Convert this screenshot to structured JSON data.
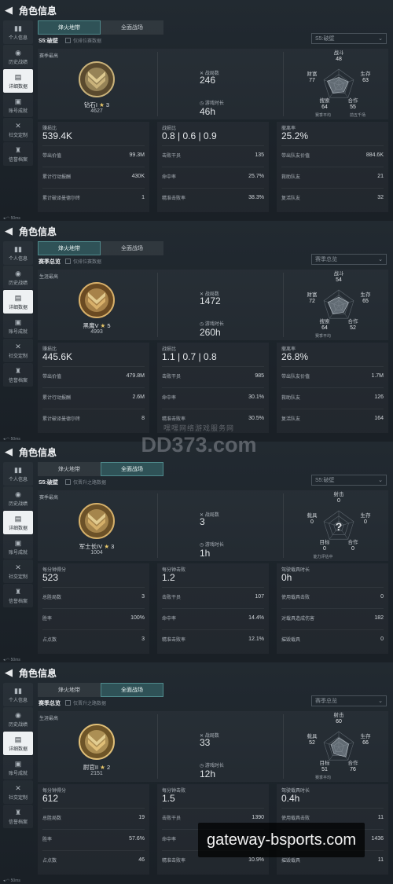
{
  "app": {
    "title": "角色信息",
    "footer": "50ms"
  },
  "sidebar": [
    "个人信息",
    "历史战绩",
    "详细数据",
    "账号成就",
    "社交定制",
    "信誉档案"
  ],
  "tabs": [
    "烽火地带",
    "全面战场"
  ],
  "watermark": {
    "site": "DD373.com",
    "sub": "嘿嘿网络游戏服务网"
  },
  "promo": {
    "text": "gateway-bsports.com"
  },
  "panels": [
    {
      "season": "S5:破壁",
      "checkbox": "仅排位赛数据",
      "dropdown": "S5:破壁",
      "main_label": "赛季最高",
      "rank_name": "钻石I",
      "rank_star": "3",
      "rank_points": "4627",
      "mid": [
        {
          "k": "战局数",
          "v": "246"
        },
        {
          "k": "游戏时长",
          "v": "46h"
        }
      ],
      "radar": {
        "labels": [
          "战斗",
          "生存",
          "合作",
          "搜索",
          "财富"
        ],
        "values": [
          "48",
          "63",
          "55",
          "64",
          "77"
        ],
        "legend": [
          "赛季平均",
          "前五千场"
        ]
      },
      "cols": [
        {
          "hk": "赚损比",
          "hv": "539.4K",
          "rows": [
            [
              "带出价值",
              "99.3M"
            ],
            [
              "累计行动报酬",
              "430K"
            ],
            [
              "累计破译曼德尔砖",
              "1"
            ]
          ]
        },
        {
          "hk": "战损比",
          "hv": "0.8 | 0.6 | 0.9",
          "rows": [
            [
              "击败干员",
              "135"
            ],
            [
              "命中率",
              "25.7%"
            ],
            [
              "精准击败率",
              "38.3%"
            ]
          ]
        },
        {
          "hk": "撤离率",
          "hv": "25.2%",
          "rows": [
            [
              "带出队友价值",
              "884.6K"
            ],
            [
              "救助队友",
              "21"
            ],
            [
              "复活队友",
              "32"
            ]
          ]
        }
      ]
    },
    {
      "season": "赛季总览",
      "checkbox": "仅排位赛数据",
      "dropdown": "赛季总览",
      "main_label": "生涯最高",
      "rank_name": "黑鹰V",
      "rank_star": "5",
      "rank_points": "4993",
      "mid": [
        {
          "k": "战局数",
          "v": "1472"
        },
        {
          "k": "游戏时长",
          "v": "260h"
        }
      ],
      "radar": {
        "labels": [
          "战斗",
          "生存",
          "合作",
          "搜索",
          "财富"
        ],
        "values": [
          "54",
          "65",
          "52",
          "64",
          "72"
        ],
        "legend": [
          "赛季平均"
        ]
      },
      "cols": [
        {
          "hk": "赚损比",
          "hv": "445.6K",
          "rows": [
            [
              "带出价值",
              "479.8M"
            ],
            [
              "累计行动报酬",
              "2.6M"
            ],
            [
              "累计破译曼德尔砖",
              "8"
            ]
          ]
        },
        {
          "hk": "战损比",
          "hv": "1.1 | 0.7 | 0.8",
          "rows": [
            [
              "击败干员",
              "985"
            ],
            [
              "命中率",
              "30.1%"
            ],
            [
              "精准击败率",
              "30.5%"
            ]
          ]
        },
        {
          "hk": "撤离率",
          "hv": "26.8%",
          "rows": [
            [
              "带出队友价值",
              "1.7M"
            ],
            [
              "救助队友",
              "126"
            ],
            [
              "复活队友",
              "164"
            ]
          ]
        }
      ]
    },
    {
      "season": "S5:破壁",
      "checkbox": "仅晋升之路数据",
      "dropdown": "S5:破壁",
      "main_label": "赛季最高",
      "rank_name": "军士长IV",
      "rank_star": "3",
      "rank_points": "1004",
      "mid": [
        {
          "k": "战局数",
          "v": "3"
        },
        {
          "k": "游戏时长",
          "v": "1h"
        }
      ],
      "radar": {
        "labels": [
          "射击",
          "生存",
          "合作",
          "目标",
          "载具"
        ],
        "values": [
          "0",
          "0",
          "0",
          "0",
          "0"
        ],
        "legend": [
          "能力评估中"
        ]
      },
      "cols": [
        {
          "hk": "每分钟得分",
          "hv": "523",
          "rows": [
            [
              "总胜局数",
              "3"
            ],
            [
              "胜率",
              "100%"
            ],
            [
              "占点数",
              "3"
            ]
          ]
        },
        {
          "hk": "每分钟击败",
          "hv": "1.2",
          "rows": [
            [
              "击败干员",
              "107"
            ],
            [
              "命中率",
              "14.4%"
            ],
            [
              "精准击败率",
              "12.1%"
            ]
          ]
        },
        {
          "hk": "驾驶载具时长",
          "hv": "0h",
          "rows": [
            [
              "使用载具击败",
              "0"
            ],
            [
              "对载具造成伤害",
              "182"
            ],
            [
              "摧毁载具",
              "0"
            ]
          ]
        }
      ]
    },
    {
      "season": "赛季总览",
      "checkbox": "仅晋升之路数据",
      "dropdown": "赛季总览",
      "main_label": "生涯最高",
      "rank_name": "尉官II",
      "rank_star": "2",
      "rank_points": "2151",
      "mid": [
        {
          "k": "战局数",
          "v": "33"
        },
        {
          "k": "游戏时长",
          "v": "12h"
        }
      ],
      "radar": {
        "labels": [
          "射击",
          "生存",
          "合作",
          "目标",
          "载具"
        ],
        "values": [
          "60",
          "66",
          "76",
          "51",
          "52"
        ],
        "legend": [
          "赛季平均"
        ]
      },
      "cols": [
        {
          "hk": "每分钟得分",
          "hv": "612",
          "rows": [
            [
              "总胜局数",
              "19"
            ],
            [
              "胜率",
              "57.6%"
            ],
            [
              "占点数",
              "46"
            ]
          ]
        },
        {
          "hk": "每分钟击败",
          "hv": "1.5",
          "rows": [
            [
              "击败干员",
              "1390"
            ],
            [
              "命中率",
              "15.9%"
            ],
            [
              "精准击败率",
              "10.9%"
            ]
          ]
        },
        {
          "hk": "驾驶载具时长",
          "hv": "0.4h",
          "rows": [
            [
              "使用载具击败",
              "11"
            ],
            [
              "对载具造成伤害",
              "1436"
            ],
            [
              "摧毁载具",
              "11"
            ]
          ]
        }
      ]
    }
  ]
}
